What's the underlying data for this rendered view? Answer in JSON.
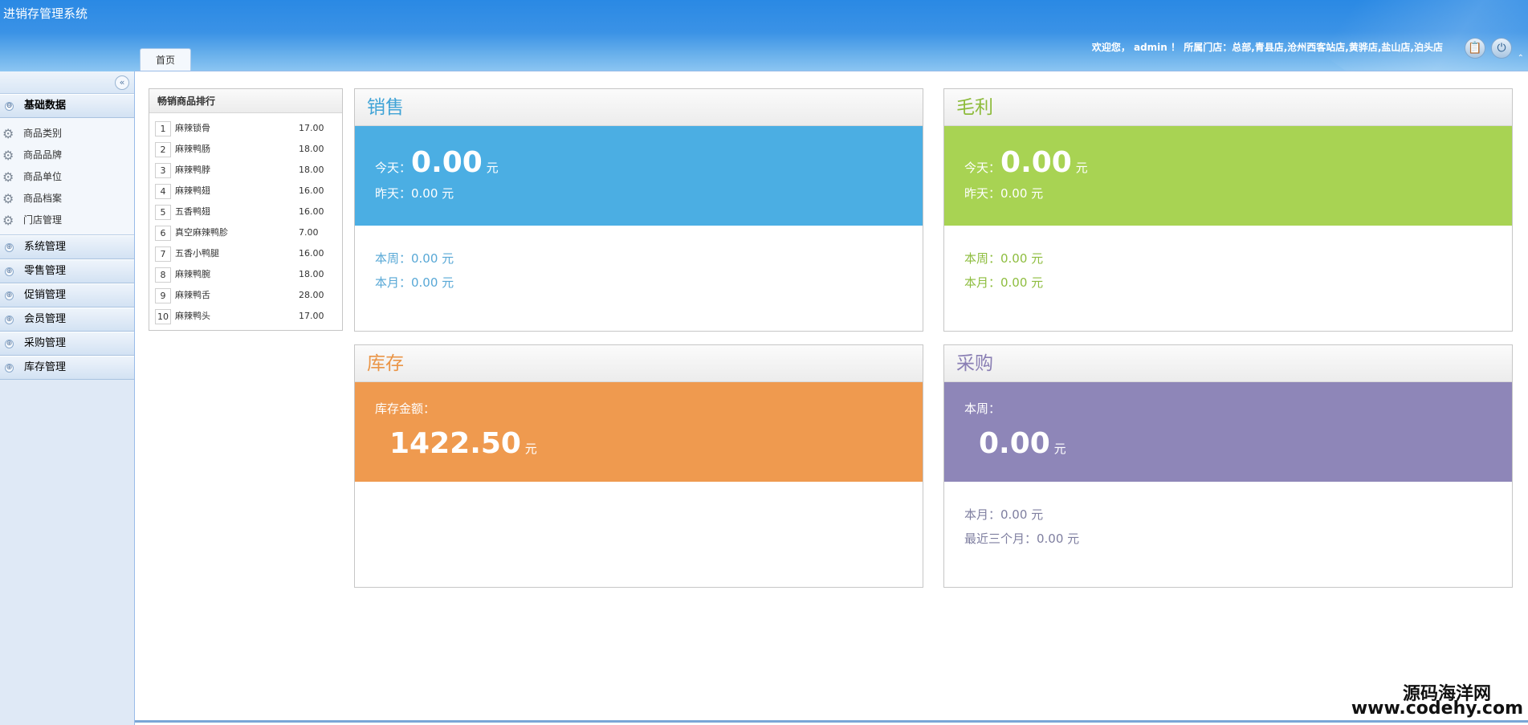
{
  "header": {
    "title": "进销存管理系统",
    "welcome": "欢迎您， admin ！ 所属门店：总部,青县店,沧州西客站店,黄骅店,盐山店,泊头店",
    "clip_icon": "clipboard-icon",
    "power_icon": "power-icon",
    "collapse_glyph": "⌃"
  },
  "tabs": [
    {
      "label": "首页"
    }
  ],
  "sidebar": {
    "collapse_glyph": "«",
    "groups": [
      {
        "label": "基础数据",
        "expanded": true,
        "glyph": "⊖"
      },
      {
        "label": "系统管理",
        "glyph": "⊕"
      },
      {
        "label": "零售管理",
        "glyph": "⊕"
      },
      {
        "label": "促销管理",
        "glyph": "⊕"
      },
      {
        "label": "会员管理",
        "glyph": "⊕"
      },
      {
        "label": "采购管理",
        "glyph": "⊕"
      },
      {
        "label": "库存管理",
        "glyph": "⊕"
      }
    ],
    "items": [
      {
        "label": "商品类别",
        "icon": "gear-icon"
      },
      {
        "label": "商品品牌",
        "icon": "gear-icon"
      },
      {
        "label": "商品单位",
        "icon": "gear-icon"
      },
      {
        "label": "商品档案",
        "icon": "gear-icon"
      },
      {
        "label": "门店管理",
        "icon": "gear-icon"
      }
    ]
  },
  "hot": {
    "title": "畅销商品排行",
    "rows": [
      {
        "rank": "1",
        "name": "麻辣锁骨",
        "price": "17.00"
      },
      {
        "rank": "2",
        "name": "麻辣鸭肠",
        "price": "18.00"
      },
      {
        "rank": "3",
        "name": "麻辣鸭脖",
        "price": "18.00"
      },
      {
        "rank": "4",
        "name": "麻辣鸭翅",
        "price": "16.00"
      },
      {
        "rank": "5",
        "name": "五香鸭翅",
        "price": "16.00"
      },
      {
        "rank": "6",
        "name": "真空麻辣鸭胗",
        "price": "7.00"
      },
      {
        "rank": "7",
        "name": "五香小鸭腿",
        "price": "16.00"
      },
      {
        "rank": "8",
        "name": "麻辣鸭腕",
        "price": "18.00"
      },
      {
        "rank": "9",
        "name": "麻辣鸭舌",
        "price": "28.00"
      },
      {
        "rank": "10",
        "name": "麻辣鸭头",
        "price": "17.00"
      }
    ]
  },
  "sales": {
    "title": "销售",
    "today_label": "今天：",
    "today_value": "0.00",
    "unit": "元",
    "yesterday": "昨天：0.00 元",
    "week": "本周：0.00 元",
    "month": "本月：0.00 元"
  },
  "profit": {
    "title": "毛利",
    "today_label": "今天：",
    "today_value": "0.00",
    "unit": "元",
    "yesterday": "昨天：0.00 元",
    "week": "本周：0.00 元",
    "month": "本月：0.00 元"
  },
  "stock": {
    "title": "库存",
    "amount_label": "库存金额：",
    "amount_value": "1422.50",
    "unit": "元"
  },
  "purchase": {
    "title": "采购",
    "week_label": "本周：",
    "week_value": "0.00",
    "unit": "元",
    "month": "本月：0.00 元",
    "three_months": "最近三个月：0.00 元"
  },
  "watermark": {
    "line1": "源码海洋网",
    "line2": "www.codehy.com"
  }
}
